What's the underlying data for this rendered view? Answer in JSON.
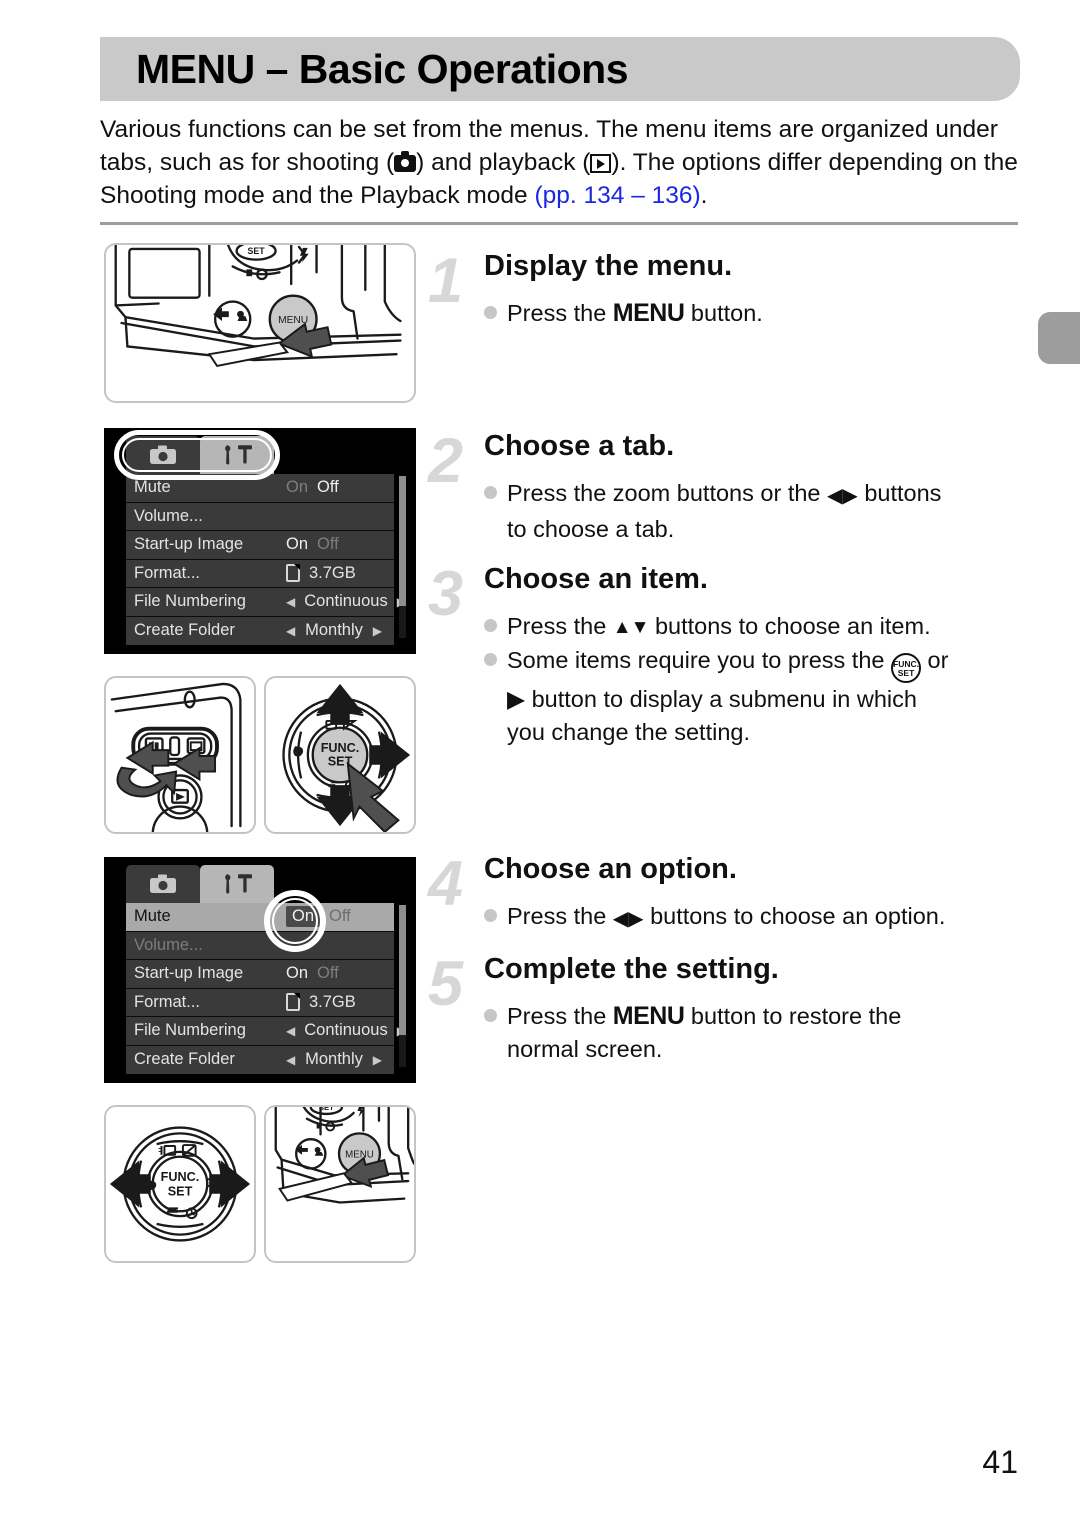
{
  "header": {
    "title": "MENU – Basic Operations"
  },
  "intro": {
    "part1": "Various functions can be set from the menus. The menu items are organized under tabs, such as for shooting (",
    "part2": ") and playback (",
    "part3": "). The options differ depending on the Shooting mode and the Playback mode ",
    "link": "(pp. 134 – 136)",
    "period": ".",
    "shooting_icon": "camera-icon",
    "playback_icon": "playback-icon"
  },
  "steps": [
    {
      "number": "1",
      "title": "Display the menu.",
      "lines": [
        {
          "pre": "Press the ",
          "strong": "MENU",
          "post": " button."
        }
      ]
    },
    {
      "number": "2",
      "title": "Choose a tab.",
      "lines": [
        {
          "pre": "Press the zoom buttons or the ",
          "glyph": "◀▶",
          "post": " buttons"
        },
        {
          "cont": "to choose a tab."
        }
      ]
    },
    {
      "number": "3",
      "title": "Choose an item.",
      "lines": [
        {
          "pre": "Press the ",
          "glyph": "▲▼",
          "post": " buttons to choose an item."
        },
        {
          "pre": "Some items require you to press the ",
          "icon": "func-set-icon",
          "post": " or"
        },
        {
          "cont": "▶ button to display a submenu in which"
        },
        {
          "cont": "you change the setting."
        }
      ]
    },
    {
      "number": "4",
      "title": "Choose an option.",
      "lines": [
        {
          "pre": "Press the ",
          "glyph": "◀▶",
          "post": " buttons to choose an option."
        }
      ]
    },
    {
      "number": "5",
      "title": "Complete the setting.",
      "lines": [
        {
          "pre": "Press the ",
          "strong": "MENU",
          "post": " button to restore the"
        },
        {
          "cont": "normal screen."
        }
      ]
    }
  ],
  "menu_screen_1": {
    "tabs": [
      {
        "name": "shooting-tab",
        "icon": "camera-icon",
        "active": false
      },
      {
        "name": "settings-tab",
        "icon": "wrench-hammer-icon",
        "active": true
      }
    ],
    "rows": [
      {
        "label": "Mute",
        "type": "onoff",
        "on": "On",
        "off": "Off",
        "selected": "Off"
      },
      {
        "label": "Volume...",
        "type": "plain",
        "value": ""
      },
      {
        "label": "Start-up Image",
        "type": "onoff",
        "on": "On",
        "off": "Off",
        "selected": "On"
      },
      {
        "label": "Format...",
        "type": "card",
        "value": "3.7GB"
      },
      {
        "label": "File Numbering",
        "type": "spin",
        "value": "Continuous"
      },
      {
        "label": "Create Folder",
        "type": "spin",
        "value": "Monthly"
      }
    ],
    "highlight": "tabs"
  },
  "menu_screen_2": {
    "tabs": [
      {
        "name": "shooting-tab",
        "icon": "camera-icon",
        "active": false
      },
      {
        "name": "settings-tab",
        "icon": "wrench-hammer-icon",
        "active": true
      }
    ],
    "rows": [
      {
        "label": "Mute",
        "type": "onoff",
        "on": "On",
        "off": "Off",
        "selected": "On",
        "row_highlight": true
      },
      {
        "label": "Volume...",
        "type": "plain",
        "value": "",
        "dim": true
      },
      {
        "label": "Start-up Image",
        "type": "onoff",
        "on": "On",
        "off": "Off",
        "selected": "On"
      },
      {
        "label": "Format...",
        "type": "card",
        "value": "3.7GB"
      },
      {
        "label": "File Numbering",
        "type": "spin",
        "value": "Continuous"
      },
      {
        "label": "Create Folder",
        "type": "spin",
        "value": "Monthly"
      }
    ],
    "highlight": "mute-on-option"
  },
  "illustrations": [
    {
      "name": "camera-back-menu-button",
      "caption": "MENU"
    },
    {
      "name": "zoom-lever",
      "caption": ""
    },
    {
      "name": "control-dial-func-set-updown",
      "caption": "FUNC. SET"
    },
    {
      "name": "control-dial-func-set-leftright",
      "caption": "FUNC. SET"
    },
    {
      "name": "camera-back-menu-button-2",
      "caption": "MENU"
    }
  ],
  "page": {
    "number": "41"
  },
  "colors": {
    "header_bar": "#c9c9c9",
    "link": "#1b27e0",
    "step_number": "#d7d7d7",
    "bullet": "#c6c6c6",
    "lcd_background": "#000000",
    "lcd_row": "#3a3a3a",
    "lcd_row_highlight": "#a9a9a9",
    "edge_tab": "#9d9d9d"
  }
}
